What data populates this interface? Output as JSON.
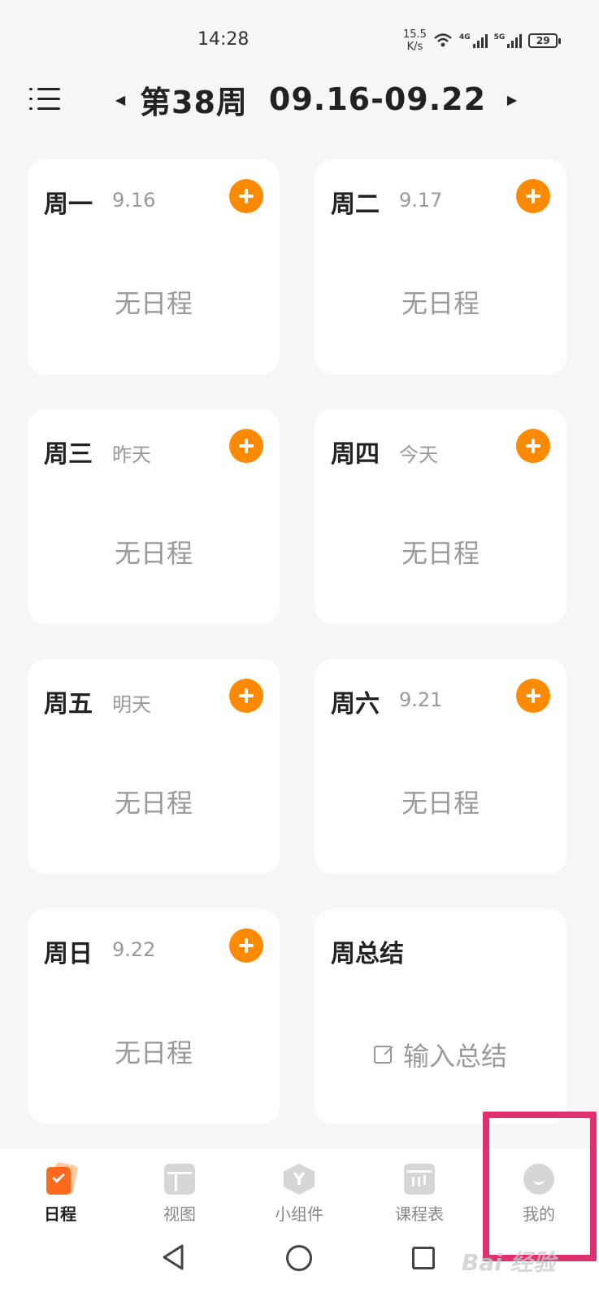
{
  "status_bar": {
    "time": "14:28",
    "net_speed_value": "15.5",
    "net_speed_unit": "K/s",
    "network_1": "4G",
    "network_2": "5G",
    "battery": "29"
  },
  "header": {
    "week_label": "第38周",
    "date_range": "09.16-09.22"
  },
  "days": [
    {
      "name": "周一",
      "date": "9.16",
      "empty_text": "无日程"
    },
    {
      "name": "周二",
      "date": "9.17",
      "empty_text": "无日程"
    },
    {
      "name": "周三",
      "date": "昨天",
      "empty_text": "无日程"
    },
    {
      "name": "周四",
      "date": "今天",
      "empty_text": "无日程"
    },
    {
      "name": "周五",
      "date": "明天",
      "empty_text": "无日程"
    },
    {
      "name": "周六",
      "date": "9.21",
      "empty_text": "无日程"
    },
    {
      "name": "周日",
      "date": "9.22",
      "empty_text": "无日程"
    }
  ],
  "summary": {
    "title": "周总结",
    "input_text": "输入总结"
  },
  "bottom_nav": {
    "items": [
      {
        "label": "日程",
        "icon": "schedule-icon",
        "active": true
      },
      {
        "label": "视图",
        "icon": "view-icon"
      },
      {
        "label": "小组件",
        "icon": "widget-icon"
      },
      {
        "label": "课程表",
        "icon": "timetable-icon"
      },
      {
        "label": "我的",
        "icon": "profile-icon"
      }
    ]
  },
  "colors": {
    "accent": "#ff8a00",
    "highlight": "#e0306f",
    "background": "#f6f6f6"
  },
  "watermark": "Bai 经验"
}
